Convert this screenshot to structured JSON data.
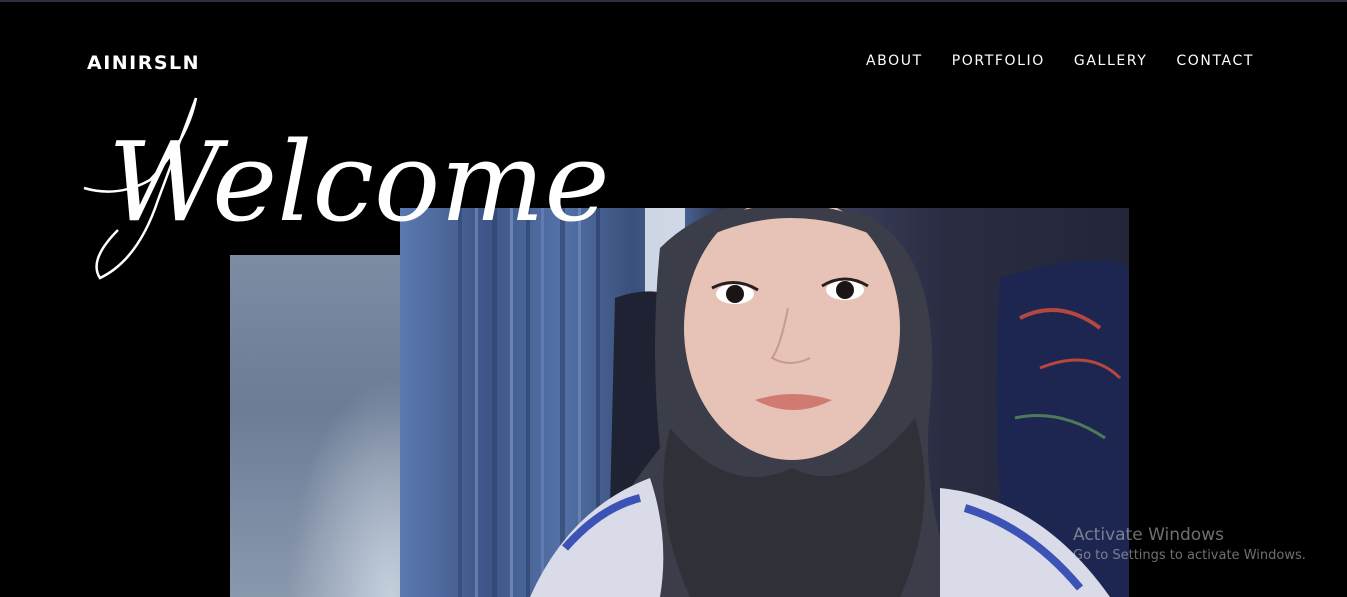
{
  "site": {
    "logo": "AINIRSLN"
  },
  "nav": {
    "items": [
      {
        "label": "ABOUT"
      },
      {
        "label": "PORTFOLIO"
      },
      {
        "label": "GALLERY"
      },
      {
        "label": "CONTACT"
      }
    ]
  },
  "hero": {
    "script_word": "Welcome",
    "photo_subject": "portrait of a woman wearing a dark hijab"
  },
  "overlay": {
    "activate_title": "Activate Windows",
    "activate_sub": "Go to Settings to activate Windows."
  }
}
